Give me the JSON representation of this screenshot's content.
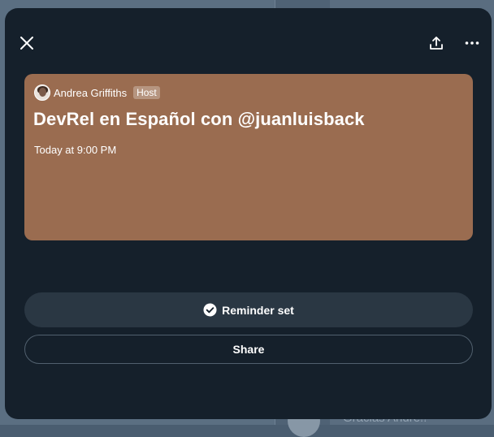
{
  "space": {
    "host_name": "Andrea Griffiths",
    "host_badge": "Host",
    "title": "DevRel en Español con @juanluisback",
    "time": "Today at 9:00 PM"
  },
  "actions": {
    "reminder_label": "Reminder set",
    "share_label": "Share"
  },
  "background": {
    "partial_text": "Gracias Andre!!"
  },
  "icons": {
    "close": "close-icon",
    "share": "share-upload-icon",
    "more": "more-horizontal-icon",
    "check": "check-circle-icon"
  },
  "colors": {
    "modal_bg": "#15202b",
    "card_bg": "#9a6c50",
    "reminder_bg": "#2a3743"
  }
}
